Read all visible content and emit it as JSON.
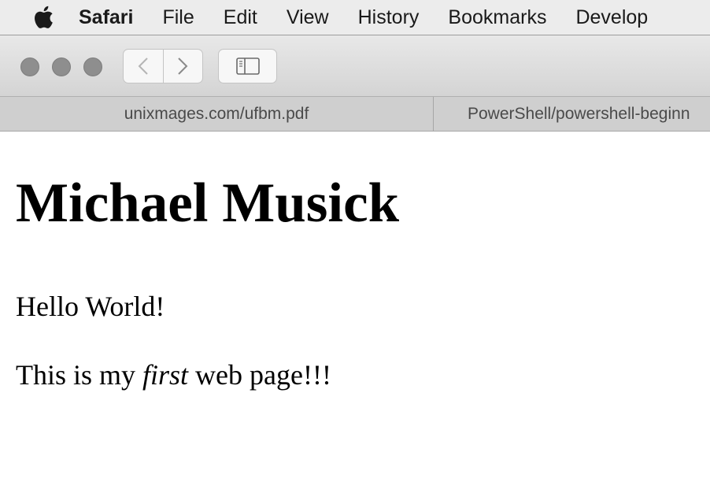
{
  "menubar": {
    "apple_icon": "apple-logo",
    "app_name": "Safari",
    "items": [
      "File",
      "Edit",
      "View",
      "History",
      "Bookmarks",
      "Develop"
    ]
  },
  "toolbar": {
    "back_icon": "chevron-left",
    "forward_icon": "chevron-right",
    "sidebar_icon": "sidebar"
  },
  "tabs": [
    {
      "label": "unixmages.com/ufbm.pdf",
      "active": false
    },
    {
      "label": "PowerShell/powershell-beginn",
      "active": false
    }
  ],
  "page": {
    "heading": "Michael Musick",
    "para1": "Hello World!",
    "para2_before": "This is my ",
    "para2_emphasis": "first",
    "para2_after": " web page!!!"
  },
  "colors": {
    "menubar_bg": "#ececec",
    "toolbar_bg": "#dcdcdc",
    "tabbar_bg": "#cfcfcf",
    "traffic_light_inactive": "#8e8e8e"
  }
}
